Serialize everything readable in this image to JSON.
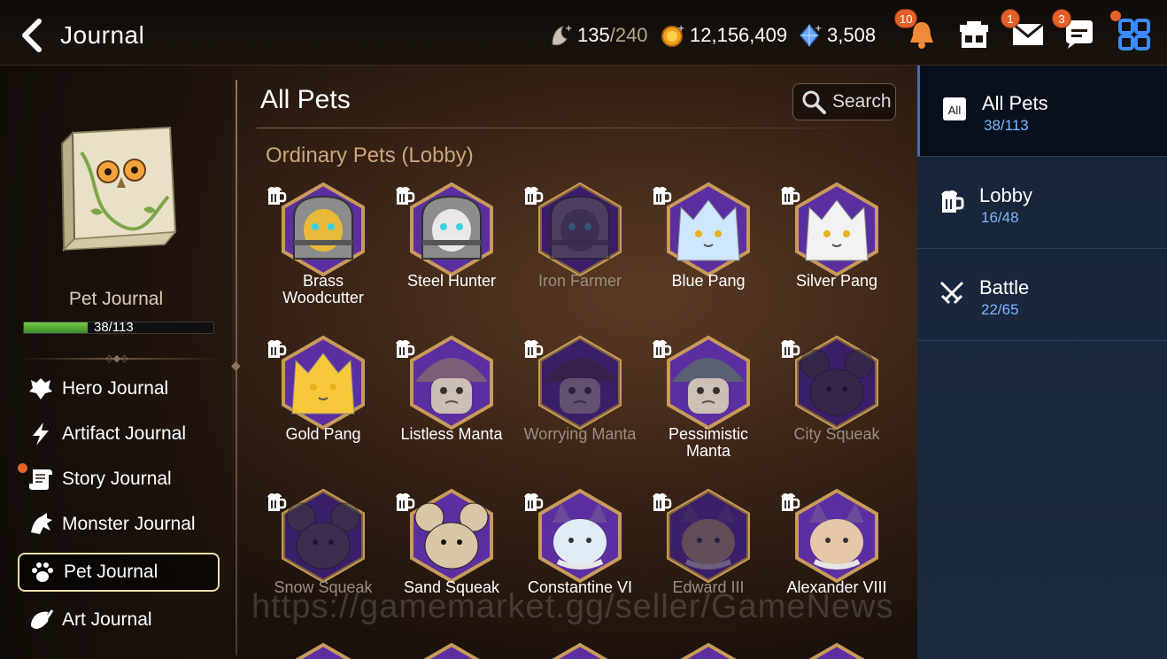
{
  "header": {
    "title": "Journal",
    "stamina": {
      "value": "135",
      "max": "/240",
      "icon": "stamina-icon"
    },
    "gold": {
      "value": "12,156,409",
      "icon": "gold-coin-icon"
    },
    "crystal": {
      "value": "3,508",
      "icon": "crystal-icon"
    },
    "notifications_badge": "10",
    "mail_badge": "1",
    "chat_badge": "3"
  },
  "sidebar": {
    "journal_name": "Pet Journal",
    "progress_text": "38/113",
    "progress_fraction": 0.336,
    "items": [
      {
        "label": "Hero Journal",
        "icon": "hero-icon"
      },
      {
        "label": "Artifact Journal",
        "icon": "lightning-icon"
      },
      {
        "label": "Story Journal",
        "icon": "scroll-icon"
      },
      {
        "label": "Monster Journal",
        "icon": "monster-icon"
      },
      {
        "label": "Pet Journal",
        "icon": "paw-icon"
      },
      {
        "label": "Art Journal",
        "icon": "palette-icon"
      }
    ]
  },
  "main": {
    "title": "All Pets",
    "search_label": "Search",
    "section_title": "Ordinary Pets (Lobby)",
    "pets": [
      {
        "name": "Brass Woodcutter",
        "locked": false,
        "type": "knight",
        "color": "#e9b93a"
      },
      {
        "name": "Steel Hunter",
        "locked": false,
        "type": "knight",
        "color": "#e8e8e8"
      },
      {
        "name": "Iron Farmer",
        "locked": true,
        "type": "knight",
        "color": "#5f5f5f"
      },
      {
        "name": "Blue Pang",
        "locked": false,
        "type": "cat",
        "color": "#cfe6ff"
      },
      {
        "name": "Silver Pang",
        "locked": false,
        "type": "cat",
        "color": "#f2f2f2"
      },
      {
        "name": "Gold Pang",
        "locked": false,
        "type": "cat",
        "color": "#f6c83a"
      },
      {
        "name": "Listless Manta",
        "locked": false,
        "type": "mushroom",
        "color": "#7c5d78"
      },
      {
        "name": "Worrying Manta",
        "locked": true,
        "type": "mushroom",
        "color": "#4c3a4e"
      },
      {
        "name": "Pessimistic Manta",
        "locked": false,
        "type": "mushroom",
        "color": "#5a5f72"
      },
      {
        "name": "City Squeak",
        "locked": true,
        "type": "mouse",
        "color": "#4a4a4a"
      },
      {
        "name": "Snow Squeak",
        "locked": true,
        "type": "mouse",
        "color": "#5a5a5a"
      },
      {
        "name": "Sand Squeak",
        "locked": false,
        "type": "mouse",
        "color": "#d8c6a6"
      },
      {
        "name": "Constantine VI",
        "locked": false,
        "type": "royal",
        "color": "#e0ecf4"
      },
      {
        "name": "Edward III",
        "locked": true,
        "type": "royal",
        "color": "#c9b276"
      },
      {
        "name": "Alexander VIII",
        "locked": false,
        "type": "royal",
        "color": "#e6c7a8"
      }
    ]
  },
  "categories": [
    {
      "name": "All Pets",
      "count": "38/113",
      "icon": "all-icon",
      "active": true
    },
    {
      "name": "Lobby",
      "count": "16/48",
      "icon": "beer-mug-icon",
      "active": false
    },
    {
      "name": "Battle",
      "count": "22/65",
      "icon": "crossed-swords-icon",
      "active": false
    }
  ],
  "watermark": "https://gamemarket.gg/seller/GameNews"
}
